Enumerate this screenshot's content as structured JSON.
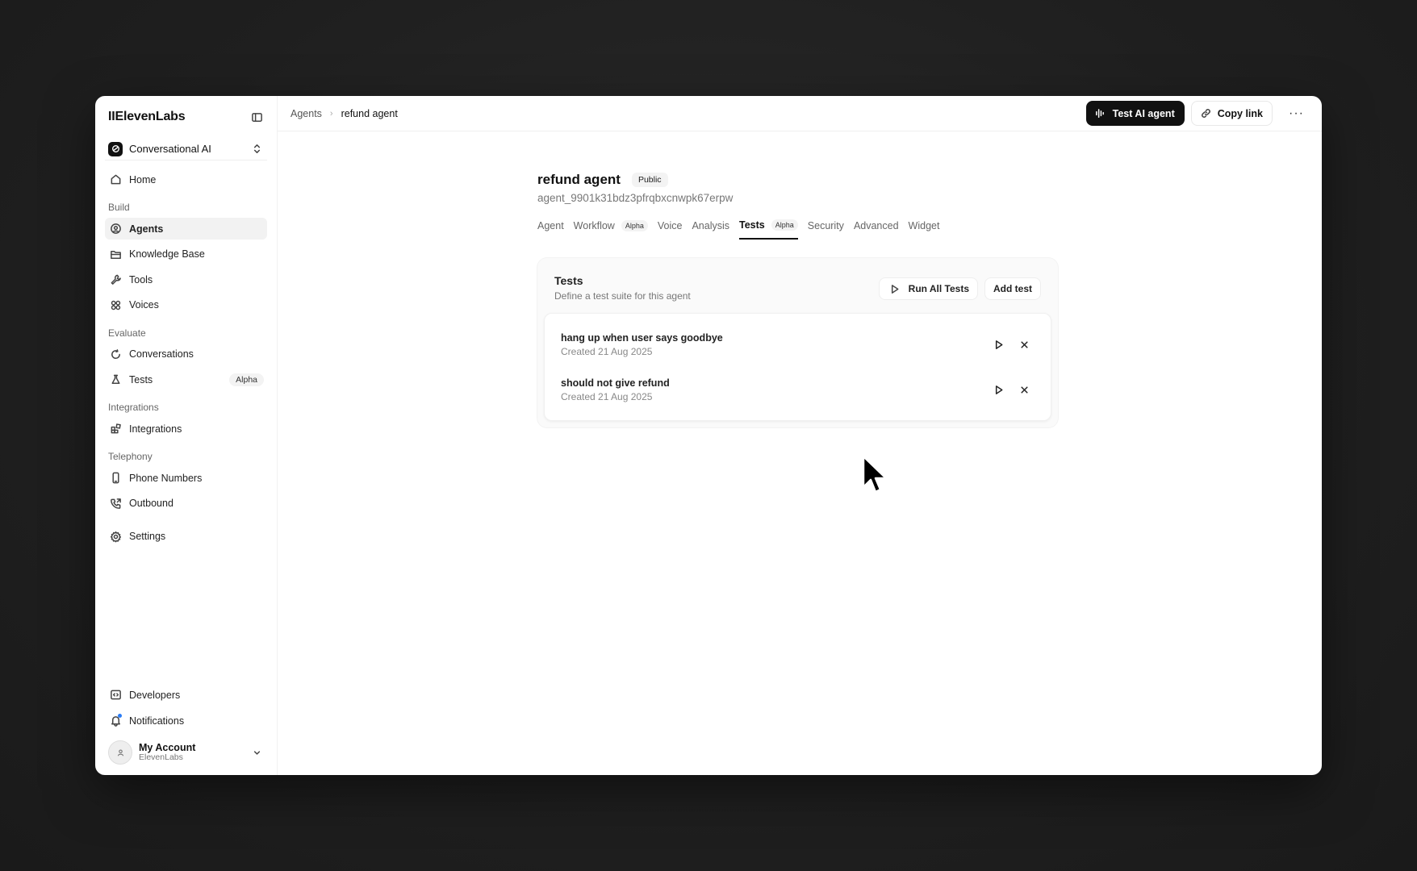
{
  "colors": {
    "accent": "#111111",
    "background": "#1f1f1f",
    "window": "#ffffff"
  },
  "sidebar": {
    "brand": "IIElevenLabs",
    "workspace": "Conversational AI",
    "home": "Home",
    "sections": {
      "build": "Build",
      "evaluate": "Evaluate",
      "integrations": "Integrations",
      "telephony": "Telephony"
    },
    "items": {
      "agents": "Agents",
      "knowledge_base": "Knowledge Base",
      "tools": "Tools",
      "voices": "Voices",
      "conversations": "Conversations",
      "tests": "Tests",
      "tests_badge": "Alpha",
      "integrations": "Integrations",
      "phone_numbers": "Phone Numbers",
      "outbound": "Outbound",
      "settings": "Settings",
      "developers": "Developers",
      "notifications": "Notifications"
    },
    "account": {
      "name": "My Account",
      "org": "ElevenLabs"
    }
  },
  "topbar": {
    "breadcrumb": [
      "Agents",
      "refund agent"
    ],
    "test_button": "Test AI agent",
    "copy_link": "Copy link",
    "more": "···"
  },
  "agent": {
    "name": "refund agent",
    "visibility": "Public",
    "id": "agent_9901k31bdz3pfrqbxcnwpk67erpw"
  },
  "tabs": [
    {
      "label": "Agent",
      "badge": ""
    },
    {
      "label": "Workflow",
      "badge": "Alpha"
    },
    {
      "label": "Voice",
      "badge": ""
    },
    {
      "label": "Analysis",
      "badge": ""
    },
    {
      "label": "Tests",
      "badge": "Alpha",
      "active": true
    },
    {
      "label": "Security",
      "badge": ""
    },
    {
      "label": "Advanced",
      "badge": ""
    },
    {
      "label": "Widget",
      "badge": ""
    }
  ],
  "tests_card": {
    "title": "Tests",
    "description": "Define a test suite for this agent",
    "run_all": "Run All Tests",
    "add": "Add test",
    "tests": [
      {
        "name": "hang up when user says goodbye",
        "created": "Created 21 Aug 2025"
      },
      {
        "name": "should not give refund",
        "created": "Created 21 Aug 2025"
      }
    ]
  }
}
